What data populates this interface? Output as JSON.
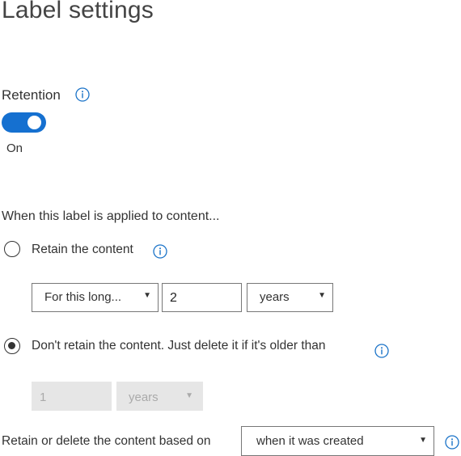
{
  "page": {
    "title": "Label settings"
  },
  "retention": {
    "label": "Retention",
    "toggle_state": "On",
    "enabled": true
  },
  "applied": {
    "heading": "When this label is applied to content..."
  },
  "retain_option": {
    "label": "Retain the content",
    "selected": false,
    "duration_select": "For this long...",
    "amount": "2",
    "unit_select": "years"
  },
  "delete_option": {
    "label": "Don't retain the content. Just delete it if it's older than",
    "selected": true,
    "amount": "1",
    "unit_select": "years"
  },
  "based_on": {
    "label": "Retain or delete the content based on",
    "select_value": "when it was created"
  },
  "colors": {
    "accent": "#1570d0",
    "info_icon": "#1a73c8",
    "disabled_bg": "#e6e6e6"
  }
}
